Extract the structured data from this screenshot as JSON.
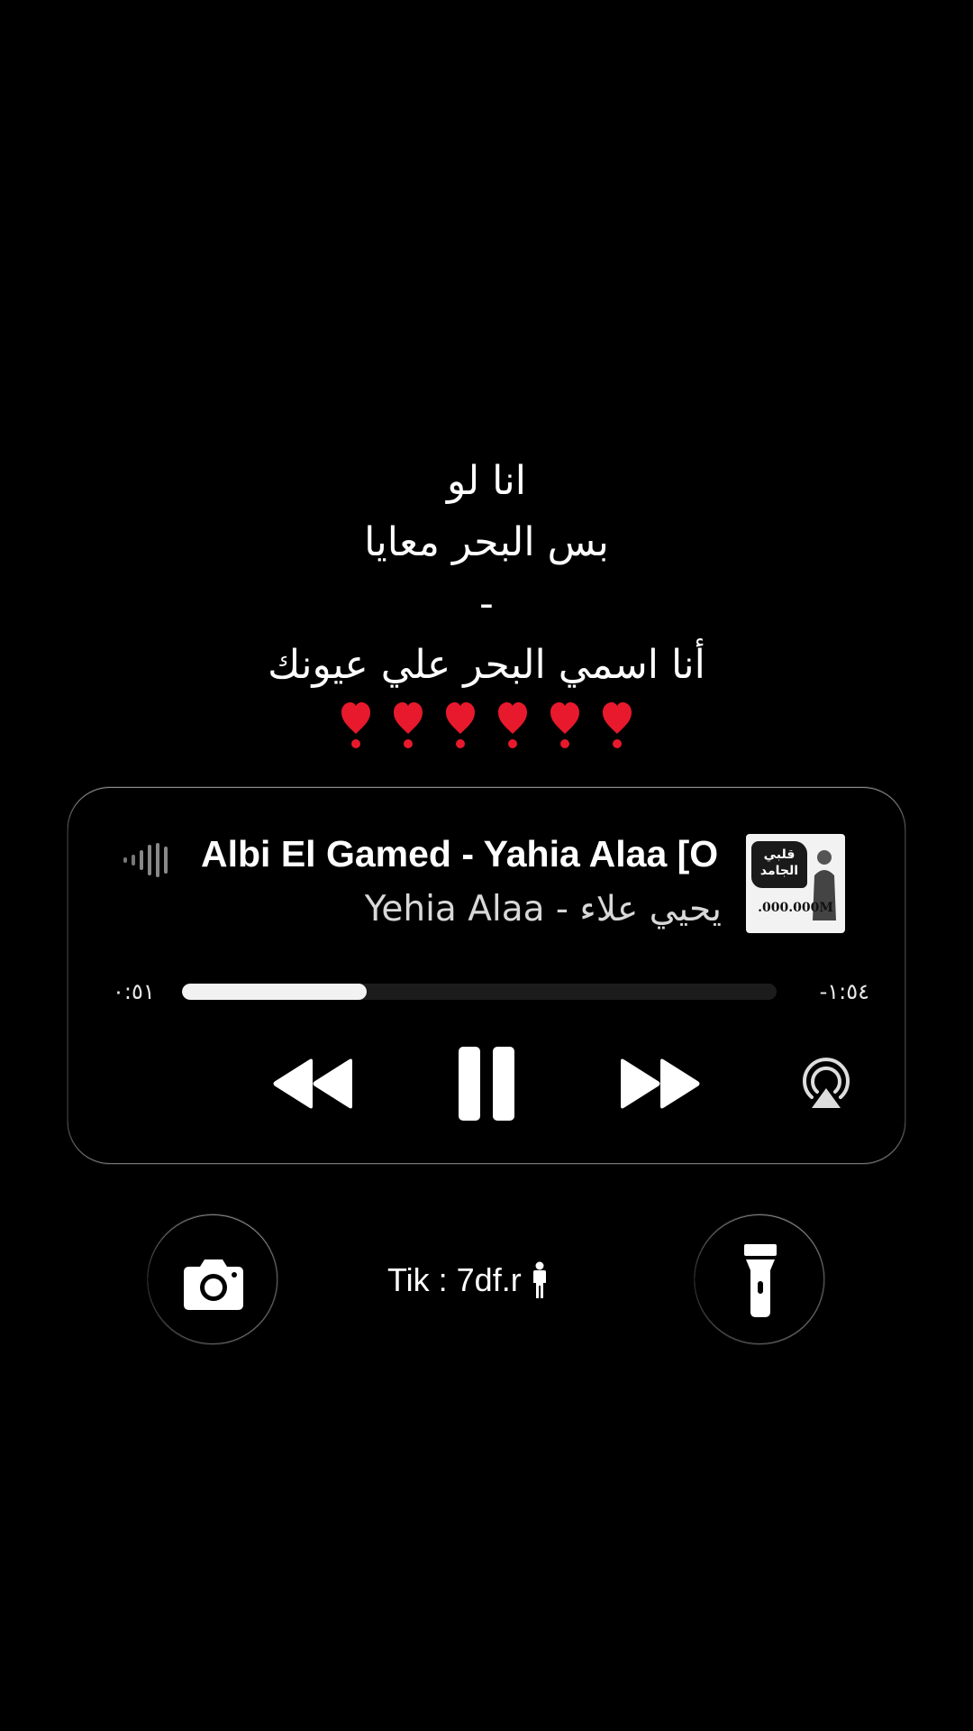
{
  "lyrics": {
    "lines": [
      "انا لو",
      "بس البحر معايا",
      "-",
      "أنا اسمي البحر علي عيونك"
    ],
    "heart_count": 6,
    "heart_color": "#e8192c"
  },
  "player": {
    "title": "Albi El Gamed - Yahia Alaa [O",
    "artist": "Yehia Alaa - يحيي علاء",
    "artwork": {
      "logo_text": "قلبي الجامد",
      "views_text": ".000.000M"
    },
    "elapsed": "٠:٥١",
    "remaining": "-١:٥٤",
    "progress": 0.31,
    "controls": {
      "rewind_icon": "rewind-icon",
      "pause_icon": "pause-icon",
      "forward_icon": "fast-forward-icon",
      "airplay_icon": "airplay-audio-icon"
    }
  },
  "bottom": {
    "camera_icon": "camera-icon",
    "flashlight_icon": "flashlight-icon",
    "handle": "Tik : 7df.r",
    "person_icon": "person-standing-icon"
  },
  "colors": {
    "background": "#000000",
    "text": "#ffffff",
    "progress_fill": "#f2f2f2",
    "progress_track": "#1c1c1c"
  }
}
